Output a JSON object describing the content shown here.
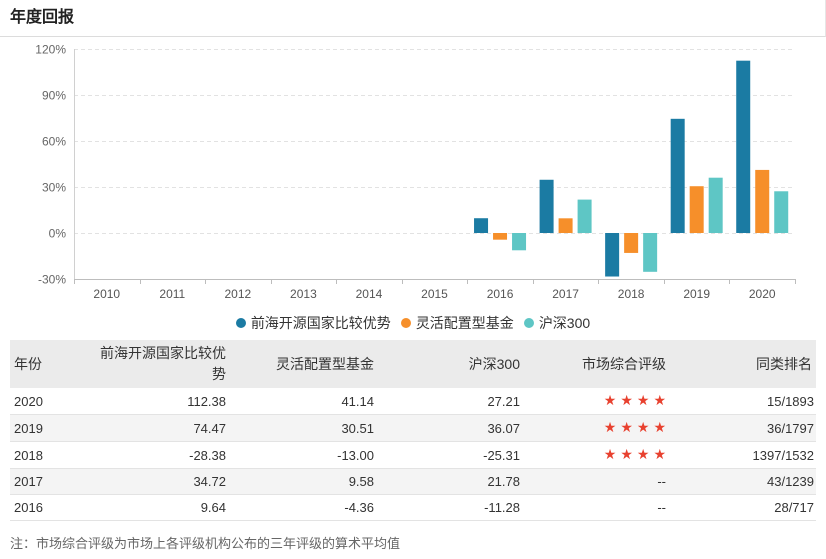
{
  "header": {
    "title": "年度回报"
  },
  "chart_data": {
    "type": "bar",
    "title": "",
    "xlabel": "",
    "ylabel": "",
    "categories": [
      "2010",
      "2011",
      "2012",
      "2013",
      "2014",
      "2015",
      "2016",
      "2017",
      "2018",
      "2019",
      "2020"
    ],
    "series": [
      {
        "name": "前海开源国家比较优势",
        "color": "#1b7ba3",
        "values": [
          null,
          null,
          null,
          null,
          null,
          null,
          9.64,
          34.72,
          -28.38,
          74.47,
          112.38
        ]
      },
      {
        "name": "灵活配置型基金",
        "color": "#f68f2a",
        "values": [
          null,
          null,
          null,
          null,
          null,
          null,
          -4.36,
          9.58,
          -13.0,
          30.51,
          41.14
        ]
      },
      {
        "name": "沪深300",
        "color": "#5ec6c5",
        "values": [
          null,
          null,
          null,
          null,
          null,
          null,
          -11.28,
          21.78,
          -25.31,
          36.07,
          27.21
        ]
      }
    ],
    "y_ticks": [
      120,
      90,
      60,
      30,
      0,
      -30
    ],
    "y_tick_labels": [
      "120%",
      "90%",
      "60%",
      "30%",
      "0%",
      "-30%"
    ],
    "ylim": [
      -30,
      120
    ],
    "grid": true,
    "legend_position": "bottom"
  },
  "table": {
    "columns": [
      "年份",
      "前海开源国家比较优势",
      "灵活配置型基金",
      "沪深300",
      "市场综合评级",
      "同类排名"
    ],
    "star_color": "#e8412f",
    "rows": [
      {
        "year": "2020",
        "fund": "112.38",
        "flexible": "41.14",
        "csi300": "27.21",
        "rating": 4,
        "rank": "15/1893"
      },
      {
        "year": "2019",
        "fund": "74.47",
        "flexible": "30.51",
        "csi300": "36.07",
        "rating": 4,
        "rank": "36/1797"
      },
      {
        "year": "2018",
        "fund": "-28.38",
        "flexible": "-13.00",
        "csi300": "-25.31",
        "rating": 4,
        "rank": "1397/1532"
      },
      {
        "year": "2017",
        "fund": "34.72",
        "flexible": "9.58",
        "csi300": "21.78",
        "rating": "--",
        "rank": "43/1239"
      },
      {
        "year": "2016",
        "fund": "9.64",
        "flexible": "-4.36",
        "csi300": "-11.28",
        "rating": "--",
        "rank": "28/717"
      }
    ]
  },
  "note": "注：市场综合评级为市场上各评级机构公布的三年评级的算术平均值"
}
